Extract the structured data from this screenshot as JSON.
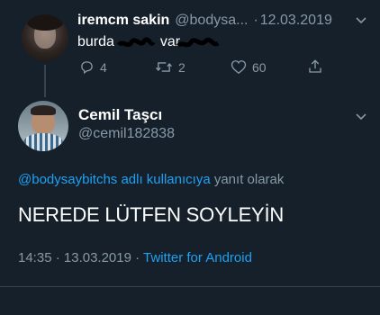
{
  "reply_to_tweet": {
    "display_name": "iremcm sakin",
    "handle": "@bodysa...",
    "separator": "·",
    "date": "12.03.2019",
    "text_prefix": "burda",
    "text_middle": "var",
    "counts": {
      "replies": "4",
      "retweets": "2",
      "likes": "60"
    }
  },
  "main_tweet": {
    "display_name": "Cemil Taşcı",
    "handle": "@cemil182838",
    "reply_context_handle": "@bodysaybitchs adlı kullanıcıya",
    "reply_context_suffix": "yanıt olarak",
    "text": "NEREDE LÜTFEN SOYLEYİN",
    "time": "14:35",
    "separator": "·",
    "date": "13.03.2019",
    "source": "Twitter for Android"
  },
  "icons": {
    "reply": "reply-icon",
    "retweet": "retweet-icon",
    "like": "heart-icon",
    "share": "share-icon",
    "caret": "chevron-down-icon"
  },
  "colors": {
    "background": "#15202b",
    "muted": "#8899a6",
    "link": "#1da1f2",
    "divider": "#38444d"
  }
}
